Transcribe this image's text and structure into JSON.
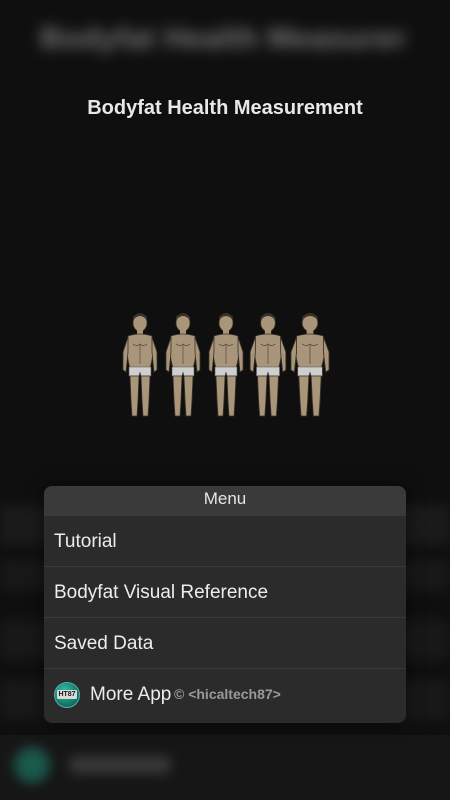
{
  "background": {
    "blurred_title": "Bodyfat Health Measurement"
  },
  "page": {
    "title": "Bodyfat Health Measurement"
  },
  "menu": {
    "header": "Menu",
    "items": [
      {
        "label": "Tutorial"
      },
      {
        "label": "Bodyfat Visual Reference"
      },
      {
        "label": "Saved Data"
      },
      {
        "label": "More App"
      }
    ],
    "app_icon_text": "HT87",
    "watermark": "© <hicaltech87>"
  },
  "colors": {
    "background": "#0f0f0f",
    "menu_bg": "#2b2b2b",
    "menu_header_bg": "#3a3a3a",
    "icon_teal": "#1d8a78",
    "figure_skin": "#a8957a"
  }
}
